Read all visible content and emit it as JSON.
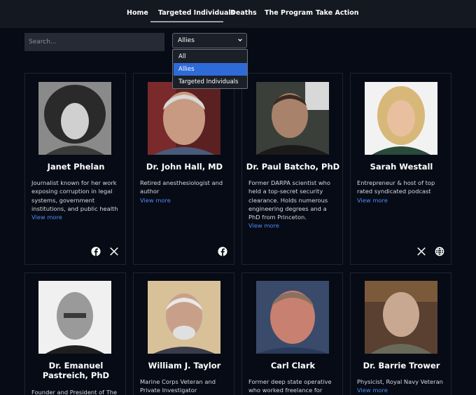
{
  "nav": {
    "items": [
      "Home",
      "Targeted Individuals",
      "Deaths",
      "The Program",
      "Take Action"
    ],
    "active": "Targeted Individuals"
  },
  "search": {
    "placeholder": "Search..."
  },
  "filter": {
    "selected": "Allies",
    "options": [
      "All",
      "Allies",
      "Targeted Individuals"
    ]
  },
  "cards": [
    {
      "name": "Janet Phelan",
      "description": "Journalist known for her work exposing corruption in legal systems, government institutions, and public health",
      "link": "View more",
      "socials": [
        "facebook-icon",
        "x-icon"
      ]
    },
    {
      "name": "Dr. John Hall, MD",
      "description": "Retired anesthesiologist and author",
      "link": "View more",
      "socials": [
        "facebook-icon"
      ]
    },
    {
      "name": "Dr. Paul Batcho, PhD",
      "description": "Former DARPA scientist who held a top-secret security clearance. Holds numerous engineering degrees and a PhD from Princeton.",
      "link": "View more",
      "socials": []
    },
    {
      "name": "Sarah Westall",
      "description": "Entrepreneur & host of top rated syndicated podcast",
      "link": "View more",
      "socials": [
        "x-icon",
        "globe-icon"
      ]
    },
    {
      "name": "Dr. Emanuel Pastreich, PhD",
      "description": "Founder and President of The",
      "link": "",
      "socials": []
    },
    {
      "name": "William J. Taylor",
      "description": "Marine Corps Veteran and Private Investigator",
      "link": "",
      "socials": []
    },
    {
      "name": "Carl Clark",
      "description": "Former deep state operative who worked freelance for",
      "link": "",
      "socials": []
    },
    {
      "name": "Dr. Barrie Trower",
      "description": "Physicist, Royal Navy Veteran",
      "link": "View more",
      "socials": []
    }
  ]
}
